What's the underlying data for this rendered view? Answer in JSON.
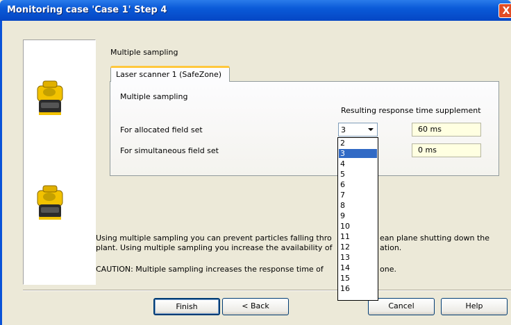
{
  "window": {
    "title": "Monitoring case 'Case 1' Step 4",
    "close_glyph": "X"
  },
  "images": [
    "safety-laser-scanner-image",
    "safety-laser-scanner-image"
  ],
  "section_label": "Multiple sampling",
  "tab": {
    "label": "Laser scanner 1 (SafeZone)"
  },
  "group_label": "Multiple sampling",
  "column_header": "Resulting response time supplement",
  "rows": [
    {
      "label": "For allocated field set",
      "response_time": "60 ms"
    },
    {
      "label": "For simultaneous field set",
      "response_time": "0 ms"
    }
  ],
  "combo": {
    "selected": "3",
    "options": [
      "2",
      "3",
      "4",
      "5",
      "6",
      "7",
      "8",
      "9",
      "10",
      "11",
      "12",
      "13",
      "14",
      "15",
      "16"
    ],
    "highlighted_index": 1
  },
  "info": {
    "line1_start": "Using multiple sampling you can prevent particles falling thro",
    "line1_end": "ean plane shutting down the",
    "line2_start": "plant. Using multiple sampling you increase the availability of",
    "line2_end": "ation.",
    "caution_start": "CAUTION: Multiple sampling increases the response time of",
    "caution_end": "one."
  },
  "buttons": {
    "finish": "Finish",
    "back": "< Back",
    "cancel": "Cancel",
    "help": "Help"
  },
  "colors": {
    "titlebar": "#0A5AD8",
    "selection": "#316AC5",
    "field_bg": "#FFFFE1",
    "scanner_yellow": "#F2C200"
  }
}
